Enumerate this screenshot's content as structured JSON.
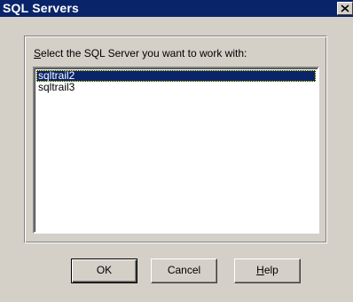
{
  "window": {
    "title": "SQL Servers",
    "colors": {
      "titlebar": "#0a246a",
      "face": "#d4d0c8",
      "selection": "#0a246a"
    }
  },
  "prompt": {
    "mnemonic": "S",
    "rest": "elect the SQL Server you want to work with:"
  },
  "servers": [
    {
      "name": "sqltrail2",
      "selected": true
    },
    {
      "name": "sqltrail3",
      "selected": false
    }
  ],
  "buttons": {
    "ok_label": "OK",
    "cancel_label": "Cancel",
    "help_mnemonic": "H",
    "help_rest": "elp"
  },
  "icons": {
    "close": "close-icon"
  }
}
